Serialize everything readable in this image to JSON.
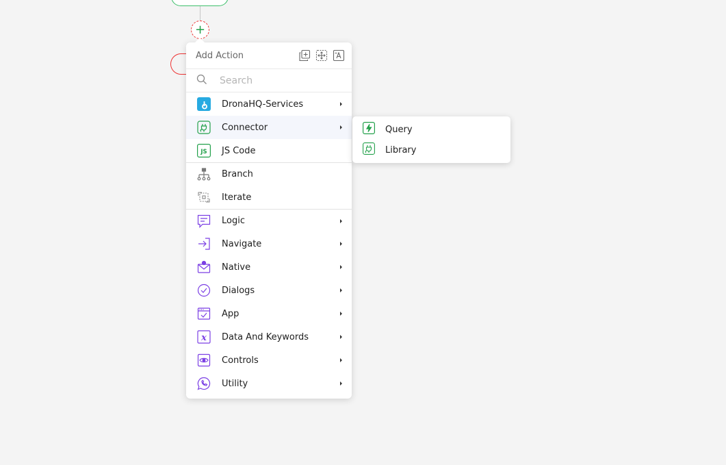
{
  "menu": {
    "title": "Add Action",
    "search_placeholder": "Search",
    "header_icons": [
      "duplicate-icon",
      "move-icon",
      "rename-icon"
    ],
    "groups": [
      [
        {
          "label": "DronaHQ-Services",
          "icon": "dronahq-icon",
          "has_submenu": true
        },
        {
          "label": "Connector",
          "icon": "plug-icon",
          "has_submenu": true,
          "active": true
        },
        {
          "label": "JS Code",
          "icon": "js-icon",
          "has_submenu": false
        }
      ],
      [
        {
          "label": "Branch",
          "icon": "branch-icon",
          "has_submenu": false
        },
        {
          "label": "Iterate",
          "icon": "iterate-icon",
          "has_submenu": false
        }
      ],
      [
        {
          "label": "Logic",
          "icon": "logic-icon",
          "has_submenu": true
        },
        {
          "label": "Navigate",
          "icon": "navigate-icon",
          "has_submenu": true
        },
        {
          "label": "Native",
          "icon": "native-icon",
          "has_submenu": true
        },
        {
          "label": "Dialogs",
          "icon": "dialogs-icon",
          "has_submenu": true
        },
        {
          "label": "App",
          "icon": "app-icon",
          "has_submenu": true
        },
        {
          "label": "Data And Keywords",
          "icon": "data-keywords-icon",
          "has_submenu": true
        },
        {
          "label": "Controls",
          "icon": "controls-icon",
          "has_submenu": true
        },
        {
          "label": "Utility",
          "icon": "utility-icon",
          "has_submenu": true
        }
      ]
    ]
  },
  "submenu": {
    "items": [
      {
        "label": "Query",
        "icon": "lightning-icon"
      },
      {
        "label": "Library",
        "icon": "plug-icon"
      }
    ]
  },
  "colors": {
    "background": "#f4f4f4",
    "green": "#22a04a",
    "purple": "#7b3fe4",
    "blue": "#27aae1",
    "red": "#e33333"
  }
}
